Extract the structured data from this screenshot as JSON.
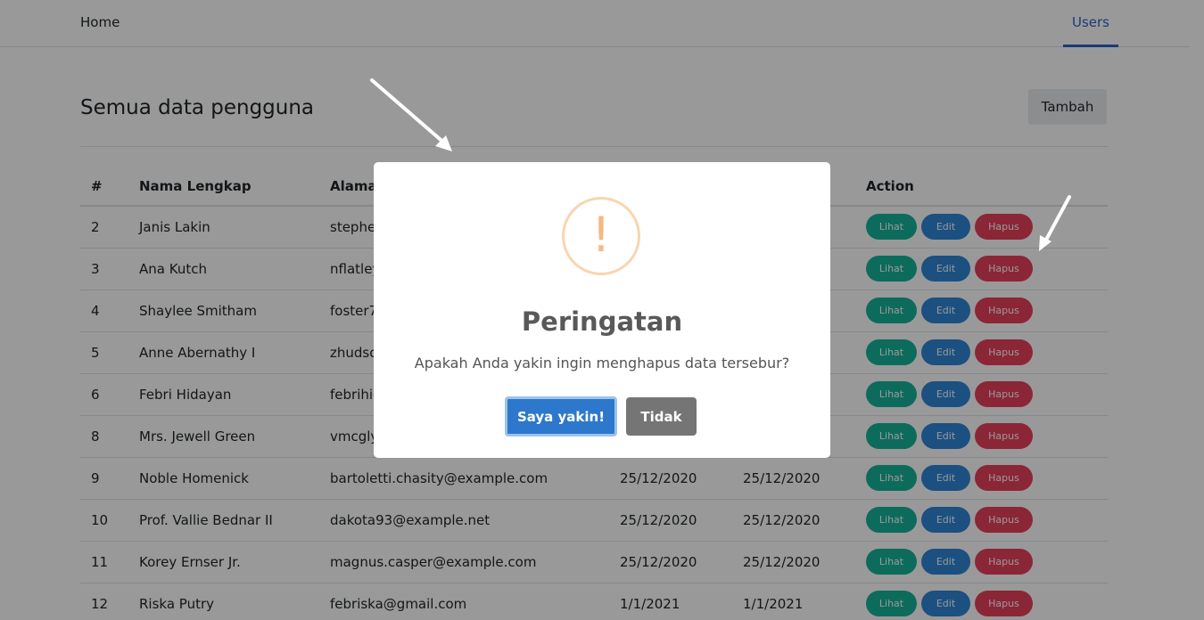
{
  "nav": {
    "home": "Home",
    "users": "Users"
  },
  "page": {
    "title": "Semua data pengguna",
    "add_button": "Tambah"
  },
  "table": {
    "headers": [
      "#",
      "Nama Lengkap",
      "Alamat Email",
      "",
      "",
      "Action"
    ],
    "rows": [
      {
        "no": "2",
        "name": "Janis Lakin",
        "email": "stephe",
        "created": "",
        "updated": ""
      },
      {
        "no": "3",
        "name": "Ana Kutch",
        "email": "nflatley",
        "created": "",
        "updated": ""
      },
      {
        "no": "4",
        "name": "Shaylee Smitham",
        "email": "foster7",
        "created": "",
        "updated": ""
      },
      {
        "no": "5",
        "name": "Anne Abernathy I",
        "email": "zhudso",
        "created": "",
        "updated": ""
      },
      {
        "no": "6",
        "name": "Febri Hidayan",
        "email": "febrihid",
        "created": "",
        "updated": ""
      },
      {
        "no": "8",
        "name": "Mrs. Jewell Green",
        "email": "vmcgly",
        "created": "",
        "updated": ""
      },
      {
        "no": "9",
        "name": "Noble Homenick",
        "email": "bartoletti.chasity@example.com",
        "created": "25/12/2020",
        "updated": "25/12/2020"
      },
      {
        "no": "10",
        "name": "Prof. Vallie Bednar II",
        "email": "dakota93@example.net",
        "created": "25/12/2020",
        "updated": "25/12/2020"
      },
      {
        "no": "11",
        "name": "Korey Ernser Jr.",
        "email": "magnus.casper@example.com",
        "created": "25/12/2020",
        "updated": "25/12/2020"
      },
      {
        "no": "12",
        "name": "Riska Putry",
        "email": "febriska@gmail.com",
        "created": "1/1/2021",
        "updated": "1/1/2021"
      }
    ],
    "actions": {
      "view": "Lihat",
      "edit": "Edit",
      "delete": "Hapus"
    }
  },
  "modal": {
    "icon": "exclamation-warning-icon",
    "title": "Peringatan",
    "message": "Apakah Anda yakin ingin menghapus data tersebur?",
    "confirm": "Saya yakin!",
    "cancel": "Tidak"
  },
  "colors": {
    "accent": "#2d63c8",
    "view": "#16b29a",
    "edit": "#2d86d6",
    "delete": "#e8405d",
    "confirm": "#2d78cc",
    "cancel": "#757575",
    "warning": "#f5b982"
  }
}
